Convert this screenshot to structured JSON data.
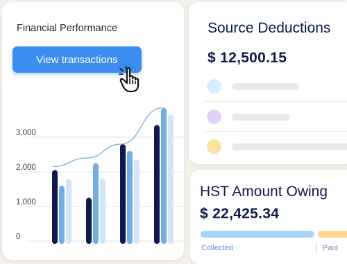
{
  "financial_performance": {
    "title": "Financial Performance",
    "button_label": "View transactions"
  },
  "chart_data": {
    "type": "bar",
    "title": "",
    "xlabel": "",
    "ylabel": "",
    "ylim": [
      0,
      3500
    ],
    "y_ticks": [
      "0",
      "1,000",
      "2,000",
      "3,000"
    ],
    "categories": [
      "",
      "",
      "",
      ""
    ],
    "series": [
      {
        "values": [
          2050,
          1250,
          2800,
          3350
        ],
        "color": "#0d1b4e"
      },
      {
        "values": [
          1600,
          2250,
          2600,
          3850
        ],
        "color": "#74ade0"
      },
      {
        "values": [
          1800,
          1800,
          2350,
          3650
        ],
        "color": "#cfe6fb"
      }
    ],
    "trend_line": {
      "values": [
        2150,
        2400,
        2800,
        3850
      ],
      "color": "#74ade0"
    }
  },
  "source_deductions": {
    "title": "Source Deductions",
    "amount": "$ 12,500.15",
    "rows": [
      {
        "dot_color": "#d9eefc"
      },
      {
        "dot_color": "#e3d2f5"
      },
      {
        "dot_color": "#fbe3a1"
      }
    ]
  },
  "hst": {
    "title": "HST Amount Owing",
    "amount": "$ 22,425.34",
    "collected_label": "Collected",
    "paid_label": "Paid",
    "collected_color": "#a9d2fa",
    "paid_color": "#fbd98b"
  }
}
